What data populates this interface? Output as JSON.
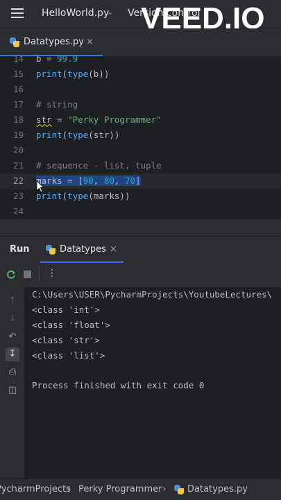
{
  "window": {
    "project_name": "HelloWorld.py",
    "vcs_label": "Version control",
    "watermark": "VEED.IO"
  },
  "editor_tabs": [
    {
      "label": "Datatypes.py",
      "active": true
    }
  ],
  "editor": {
    "lines": [
      {
        "number": "14",
        "text": "b = 99.9"
      },
      {
        "number": "15",
        "text": "print(type(b))"
      },
      {
        "number": "16",
        "text": ""
      },
      {
        "number": "17",
        "text": "# string"
      },
      {
        "number": "18",
        "text": "str = \"Perky Programmer\""
      },
      {
        "number": "19",
        "text": "print(type(str))"
      },
      {
        "number": "20",
        "text": ""
      },
      {
        "number": "21",
        "text": "# sequence - list, tuple"
      },
      {
        "number": "22",
        "text": "marks = [90, 80, 70]"
      },
      {
        "number": "23",
        "text": "print(type(marks))"
      },
      {
        "number": "24",
        "text": ""
      }
    ],
    "current_line": "22"
  },
  "run_panel": {
    "title": "Run",
    "tab_label": "Datatypes",
    "output": [
      "C:\\Users\\USER\\PycharmProjects\\YoutubeLectures\\",
      "<class 'int'>",
      "<class 'float'>",
      "<class 'str'>",
      "<class 'list'>",
      "",
      "Process finished with exit code 0"
    ]
  },
  "statusbar": {
    "breadcrumbs": [
      "PycharmProjects",
      "Perky Programmer",
      "Datatypes.py"
    ]
  },
  "icons": {
    "menu": "hamburger-icon",
    "python_file": "python-icon",
    "rerun": "rerun-icon",
    "stop": "stop-icon",
    "more": "more-vertical-icon",
    "up": "arrow-up-icon",
    "down": "arrow-down-icon",
    "soft_wrap": "soft-wrap-icon",
    "scroll_to_end": "scroll-to-end-icon",
    "print": "print-icon",
    "trash": "trash-icon"
  },
  "colors": {
    "accent": "#3574f0",
    "editor_bg": "#1e1f22",
    "chrome_bg": "#2b2d30",
    "selection": "#214283",
    "function": "#56a8f5",
    "number": "#2aacb8",
    "string": "#6aab73",
    "comment": "#7a7e85"
  }
}
